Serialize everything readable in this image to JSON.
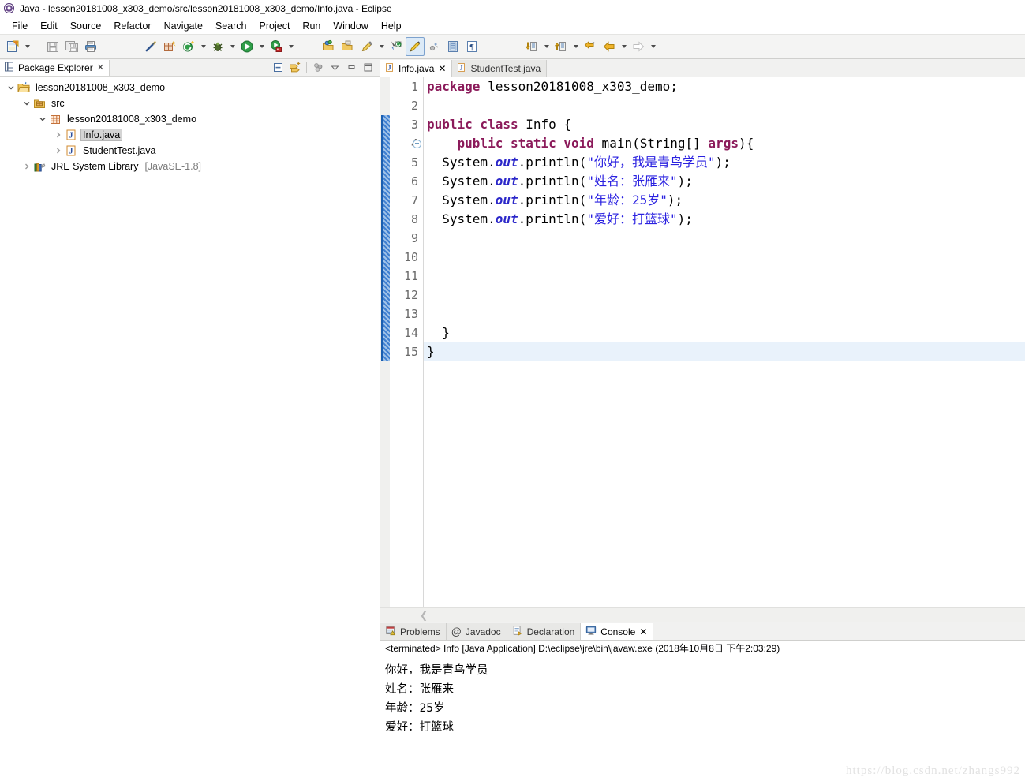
{
  "window": {
    "title": "Java - lesson20181008_x303_demo/src/lesson20181008_x303_demo/Info.java - Eclipse",
    "app_icon": "eclipse-icon"
  },
  "menubar": {
    "items": [
      {
        "label": "File"
      },
      {
        "label": "Edit"
      },
      {
        "label": "Source"
      },
      {
        "label": "Refactor"
      },
      {
        "label": "Navigate"
      },
      {
        "label": "Search"
      },
      {
        "label": "Project"
      },
      {
        "label": "Run"
      },
      {
        "label": "Window"
      },
      {
        "label": "Help"
      }
    ]
  },
  "toolbar": {
    "buttons": [
      {
        "name": "new-button",
        "icon": "new-file-icon"
      },
      {
        "name": "save-button",
        "icon": "save-icon"
      },
      {
        "name": "save-all-button",
        "icon": "save-all-icon"
      },
      {
        "name": "print-button",
        "icon": "print-icon"
      },
      {
        "name": "toggle-mark-occurrences-button",
        "icon": "pen-strike-icon"
      },
      {
        "name": "new-java-package-button",
        "icon": "package-new-icon"
      },
      {
        "name": "new-java-class-button",
        "icon": "class-new-icon"
      },
      {
        "name": "debug-button",
        "icon": "bug-icon"
      },
      {
        "name": "run-button",
        "icon": "run-green-play-icon"
      },
      {
        "name": "run-external-tools-button",
        "icon": "external-tools-icon"
      },
      {
        "name": "open-type-button",
        "icon": "open-type-icon"
      },
      {
        "name": "open-task-button",
        "icon": "open-task-icon"
      },
      {
        "name": "new-annotation-button",
        "icon": "pencil-icon"
      },
      {
        "name": "search-button",
        "icon": "search-arrow-icon"
      },
      {
        "name": "highlight-button",
        "icon": "marker-pen-icon"
      },
      {
        "name": "skip-breakpoints-button",
        "icon": "breakpoint-skip-icon"
      },
      {
        "name": "toggle-block-selection-button",
        "icon": "block-selection-icon"
      },
      {
        "name": "show-whitespace-button",
        "icon": "pilcrow-icon"
      },
      {
        "name": "next-annotation-button",
        "icon": "next-annotation-down-icon"
      },
      {
        "name": "previous-annotation-button",
        "icon": "previous-annotation-up-icon"
      },
      {
        "name": "last-edit-location-button",
        "icon": "last-edit-icon"
      },
      {
        "name": "back-button",
        "icon": "back-arrow-icon"
      },
      {
        "name": "forward-button",
        "icon": "forward-arrow-icon"
      }
    ]
  },
  "package_explorer": {
    "tab_label": "Package Explorer",
    "close_glyph": "✕",
    "toolbar": [
      {
        "name": "collapse-all-button",
        "icon": "collapse-all-icon"
      },
      {
        "name": "link-with-editor-button",
        "icon": "link-editor-icon"
      },
      {
        "name": "view-menu-button",
        "icon": "view-menu-icon"
      },
      {
        "name": "minimize-button",
        "icon": "minimize-icon"
      },
      {
        "name": "maximize-button",
        "icon": "maximize-icon"
      }
    ],
    "tree": [
      {
        "label": "lesson20181008_x303_demo",
        "icon": "java-project-icon",
        "depth": 0,
        "expanded": true,
        "selected": false,
        "suffix": ""
      },
      {
        "label": "src",
        "icon": "source-folder-icon",
        "depth": 1,
        "expanded": true,
        "selected": false,
        "suffix": ""
      },
      {
        "label": "lesson20181008_x303_demo",
        "icon": "package-icon",
        "depth": 2,
        "expanded": true,
        "selected": false,
        "suffix": ""
      },
      {
        "label": "Info.java",
        "icon": "java-file-icon",
        "depth": 3,
        "expanded": false,
        "selected": true,
        "suffix": ""
      },
      {
        "label": "StudentTest.java",
        "icon": "java-file-icon",
        "depth": 3,
        "expanded": false,
        "selected": false,
        "suffix": ""
      },
      {
        "label": "JRE System Library",
        "icon": "library-icon",
        "depth": 1,
        "expanded": false,
        "selected": false,
        "suffix": "[JavaSE-1.8]"
      }
    ]
  },
  "editor": {
    "tabs": [
      {
        "label": "Info.java",
        "icon": "java-file-icon",
        "active": true,
        "close_glyph": "✕"
      },
      {
        "label": "StudentTest.java",
        "icon": "java-file-icon",
        "active": false,
        "close_glyph": ""
      }
    ],
    "changed_marker": {
      "from_line": 3,
      "to_line": 15
    },
    "current_line": 15,
    "lines": [
      {
        "n": 1,
        "fold": false,
        "tokens": [
          {
            "t": "package",
            "c": "kw"
          },
          {
            "t": " lesson20181008_x303_demo;",
            "c": "plain"
          }
        ]
      },
      {
        "n": 2,
        "fold": false,
        "tokens": []
      },
      {
        "n": 3,
        "fold": false,
        "tokens": [
          {
            "t": "public class",
            "c": "kw"
          },
          {
            "t": " Info {",
            "c": "plain"
          }
        ]
      },
      {
        "n": 4,
        "fold": true,
        "tokens": [
          {
            "t": "    ",
            "c": "plain"
          },
          {
            "t": "public static void",
            "c": "kw"
          },
          {
            "t": " main(String[] ",
            "c": "plain"
          },
          {
            "t": "args",
            "c": "arg"
          },
          {
            "t": "){",
            "c": "plain"
          }
        ]
      },
      {
        "n": 5,
        "fold": false,
        "tokens": [
          {
            "t": "  System.",
            "c": "plain"
          },
          {
            "t": "out",
            "c": "fieldi"
          },
          {
            "t": ".println(",
            "c": "plain"
          },
          {
            "t": "\"你好，我是青鸟学员\"",
            "c": "str"
          },
          {
            "t": ");",
            "c": "plain"
          }
        ]
      },
      {
        "n": 6,
        "fold": false,
        "tokens": [
          {
            "t": "  System.",
            "c": "plain"
          },
          {
            "t": "out",
            "c": "fieldi"
          },
          {
            "t": ".println(",
            "c": "plain"
          },
          {
            "t": "\"姓名：张雁来\"",
            "c": "str"
          },
          {
            "t": ");",
            "c": "plain"
          }
        ]
      },
      {
        "n": 7,
        "fold": false,
        "tokens": [
          {
            "t": "  System.",
            "c": "plain"
          },
          {
            "t": "out",
            "c": "fieldi"
          },
          {
            "t": ".println(",
            "c": "plain"
          },
          {
            "t": "\"年龄：25岁\"",
            "c": "str"
          },
          {
            "t": ");",
            "c": "plain"
          }
        ]
      },
      {
        "n": 8,
        "fold": false,
        "tokens": [
          {
            "t": "  System.",
            "c": "plain"
          },
          {
            "t": "out",
            "c": "fieldi"
          },
          {
            "t": ".println(",
            "c": "plain"
          },
          {
            "t": "\"爱好：打篮球\"",
            "c": "str"
          },
          {
            "t": ");",
            "c": "plain"
          }
        ]
      },
      {
        "n": 9,
        "fold": false,
        "tokens": []
      },
      {
        "n": 10,
        "fold": false,
        "tokens": []
      },
      {
        "n": 11,
        "fold": false,
        "tokens": []
      },
      {
        "n": 12,
        "fold": false,
        "tokens": []
      },
      {
        "n": 13,
        "fold": false,
        "tokens": []
      },
      {
        "n": 14,
        "fold": false,
        "tokens": [
          {
            "t": "  }",
            "c": "plain"
          }
        ]
      },
      {
        "n": 15,
        "fold": false,
        "tokens": [
          {
            "t": "}",
            "c": "plain"
          }
        ]
      }
    ]
  },
  "console": {
    "tabs": [
      {
        "label": "Problems",
        "icon": "problems-icon",
        "active": false,
        "close_glyph": ""
      },
      {
        "label": "Javadoc",
        "icon": "javadoc-at-icon",
        "active": false,
        "close_glyph": ""
      },
      {
        "label": "Declaration",
        "icon": "declaration-icon",
        "active": false,
        "close_glyph": ""
      },
      {
        "label": "Console",
        "icon": "console-icon",
        "active": true,
        "close_glyph": "✕"
      }
    ],
    "status_line": "<terminated> Info [Java Application] D:\\eclipse\\jre\\bin\\javaw.exe (2018年10月8日 下午2:03:29)",
    "output": [
      "你好，我是青鸟学员",
      "姓名：张雁来",
      "年龄：25岁",
      "爱好：打篮球"
    ]
  },
  "watermark": {
    "text": "https://blog.csdn.net/zhangs992"
  },
  "colors": {
    "keyword": "#8b1a5a",
    "string": "#2a21e0",
    "field_italic": "#2b27c9",
    "current_line": "#e9f2fb",
    "selection": "#d4d4d4",
    "change_bar": "#3f7fd0",
    "toolbar_bg": "#f4f4f3",
    "tab_inactive": "#e8e8e6"
  }
}
